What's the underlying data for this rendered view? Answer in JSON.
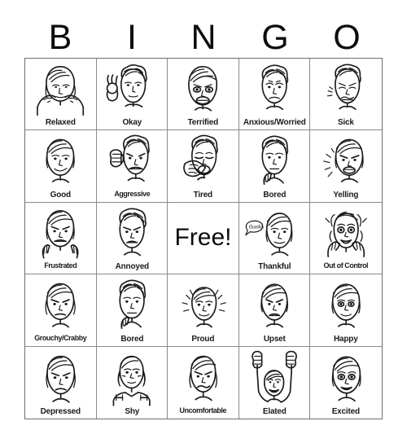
{
  "header": {
    "letters": [
      "B",
      "I",
      "N",
      "G",
      "O"
    ]
  },
  "free_space": {
    "label": "Free!"
  },
  "annotations": {
    "thankful_bubble": "thanks"
  },
  "grid": {
    "rows": 5,
    "columns": 5,
    "cells": [
      {
        "label": "Relaxed",
        "art": "relaxed-face"
      },
      {
        "label": "Okay",
        "art": "okay-face"
      },
      {
        "label": "Terrified",
        "art": "terrified-face"
      },
      {
        "label": "Anxious/Worried",
        "art": "anxious-worried-face"
      },
      {
        "label": "Sick",
        "art": "sick-face"
      },
      {
        "label": "Good",
        "art": "good-face"
      },
      {
        "label": "Aggressive",
        "art": "aggressive-face"
      },
      {
        "label": "Tired",
        "art": "tired-face"
      },
      {
        "label": "Bored",
        "art": "bored-face"
      },
      {
        "label": "Yelling",
        "art": "yelling-face"
      },
      {
        "label": "Frustrated",
        "art": "frustrated-face"
      },
      {
        "label": "Annoyed",
        "art": "annoyed-face"
      },
      {
        "label": "Free!",
        "art": "free-space"
      },
      {
        "label": "Thankful",
        "art": "thankful-face"
      },
      {
        "label": "Out of Control",
        "art": "out-of-control-face"
      },
      {
        "label": "Grouchy/Crabby",
        "art": "grouchy-crabby-face"
      },
      {
        "label": "Bored",
        "art": "bored-face-2"
      },
      {
        "label": "Proud",
        "art": "proud-face"
      },
      {
        "label": "Upset",
        "art": "upset-face"
      },
      {
        "label": "Happy",
        "art": "happy-face"
      },
      {
        "label": "Depressed",
        "art": "depressed-face"
      },
      {
        "label": "Shy",
        "art": "shy-face"
      },
      {
        "label": "Uncomfortable",
        "art": "uncomfortable-face"
      },
      {
        "label": "Elated",
        "art": "elated-face"
      },
      {
        "label": "Excited",
        "art": "excited-face"
      }
    ]
  },
  "colors": {
    "ink": "#1a1a1a",
    "grid_line": "#8a8a8a",
    "grid_border": "#6e6e6e",
    "background": "#ffffff"
  }
}
